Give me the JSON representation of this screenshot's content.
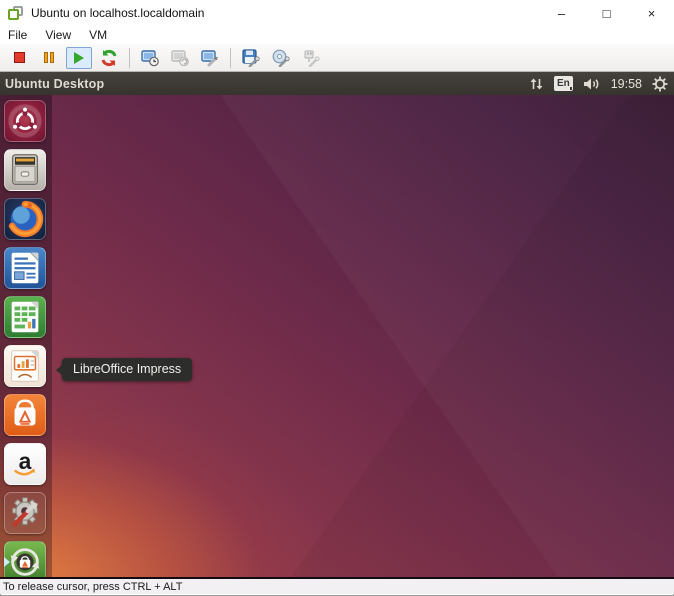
{
  "window": {
    "title": "Ubuntu on localhost.localdomain",
    "controls": {
      "minimize": "–",
      "maximize": "□",
      "close": "×"
    }
  },
  "menubar": {
    "items": [
      "File",
      "View",
      "VM"
    ]
  },
  "toolbar": {
    "buttons": [
      {
        "icon": "power-off-icon",
        "enabled": true
      },
      {
        "icon": "suspend-icon",
        "enabled": true
      },
      {
        "icon": "power-on-icon",
        "enabled": true,
        "active": true
      },
      {
        "icon": "reset-icon",
        "enabled": true
      },
      {
        "icon": "take-snapshot-icon",
        "enabled": true
      },
      {
        "icon": "revert-snapshot-icon",
        "enabled": false
      },
      {
        "icon": "manage-snapshots-icon",
        "enabled": true
      },
      {
        "icon": "floppy-device-icon",
        "enabled": true
      },
      {
        "icon": "cd-device-icon",
        "enabled": true
      },
      {
        "icon": "usb-device-icon",
        "enabled": false
      }
    ]
  },
  "unity_panel": {
    "title": "Ubuntu Desktop",
    "indicators": {
      "keyboard_layout": "En",
      "time": "19:58"
    }
  },
  "launcher": {
    "items": [
      {
        "icon": "ubuntu-dash-icon"
      },
      {
        "icon": "files-icon"
      },
      {
        "icon": "firefox-icon"
      },
      {
        "icon": "libreoffice-writer-icon"
      },
      {
        "icon": "libreoffice-calc-icon"
      },
      {
        "icon": "libreoffice-impress-icon"
      },
      {
        "icon": "software-center-icon"
      },
      {
        "icon": "amazon-icon"
      },
      {
        "icon": "system-settings-icon"
      },
      {
        "icon": "software-updater-icon"
      }
    ]
  },
  "tooltip": {
    "text": "LibreOffice Impress"
  },
  "statusbar": {
    "text": "To release cursor, press CTRL + ALT"
  },
  "colors": {
    "unity_panel_bg": "#3c3a35",
    "tooltip_bg": "#2d2d2b",
    "wallpaper_dark": "#3a1c35",
    "wallpaper_bright": "#e98540",
    "accent_orange": "#e8622d"
  }
}
